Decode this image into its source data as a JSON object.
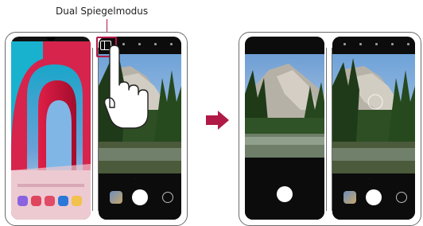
{
  "caption": {
    "label": "Dual Spiegelmodus"
  },
  "colors": {
    "accent": "#b11a46",
    "case_outline": "#6b6b6b",
    "screen_bg": "#0c0c0c",
    "shutter": "#ffffff"
  },
  "icons": {
    "dual_screen_toggle": "dual-screen-icon",
    "hand_pointer": "hand-pointer-icon",
    "arrow": "right-arrow-icon"
  }
}
